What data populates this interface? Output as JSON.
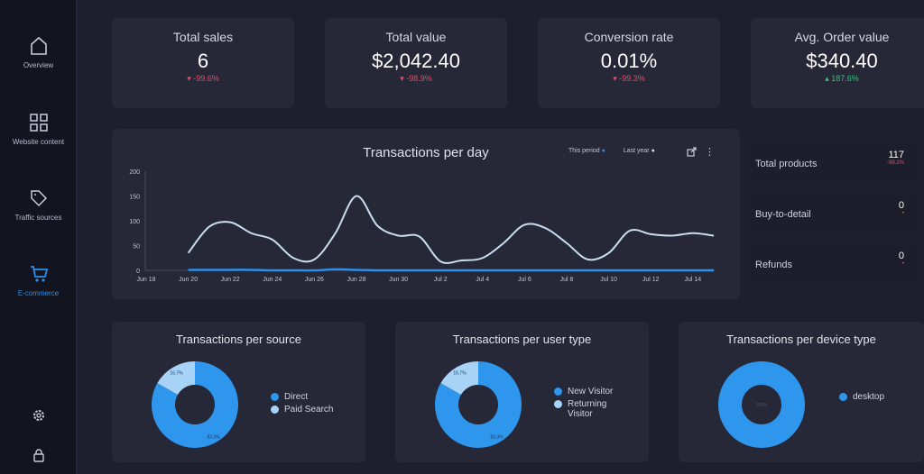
{
  "sidebar": {
    "items": [
      {
        "label": "Overview",
        "icon": "home-icon"
      },
      {
        "label": "Website content",
        "icon": "grid-icon"
      },
      {
        "label": "Traffic sources",
        "icon": "tag-icon"
      },
      {
        "label": "E-commerce",
        "icon": "cart-icon",
        "active": true
      }
    ],
    "bottom": [
      "gear-icon",
      "lock-icon"
    ]
  },
  "kpis": [
    {
      "title": "Total sales",
      "value": "6",
      "change": "-99.6%",
      "trend": "down"
    },
    {
      "title": "Total value",
      "value": "$2,042.40",
      "change": "-98.9%",
      "trend": "down"
    },
    {
      "title": "Conversion rate",
      "value": "0.01%",
      "change": "-99.3%",
      "trend": "down"
    },
    {
      "title": "Avg. Order value",
      "value": "$340.40",
      "change": "187.6%",
      "trend": "up"
    }
  ],
  "side_stats": [
    {
      "label": "Total products",
      "value": "117",
      "change": "-99.2%"
    },
    {
      "label": "Buy-to-detail",
      "value": "0",
      "change": "•"
    },
    {
      "label": "Refunds",
      "value": "0",
      "change": "•"
    }
  ],
  "colors": {
    "this_period": "#2f8ee5",
    "last_year": "#c9def0",
    "accent": "#2f8ee5",
    "negative": "#e0506a",
    "positive": "#3fbf7f"
  },
  "chart_data": [
    {
      "type": "line",
      "title": "Transactions per day",
      "legend_placement": "top-right",
      "ylim": [
        0,
        200
      ],
      "yticks": [
        "0",
        "50",
        "100",
        "150",
        "200"
      ],
      "xticks": [
        "Jun 18",
        "Jun 20",
        "Jun 22",
        "Jun 24",
        "Jun 26",
        "Jun 28",
        "Jun 30",
        "Jul 2",
        "Jul 4",
        "Jul 6",
        "Jul 8",
        "Jul 10",
        "Jul 12",
        "Jul 14"
      ],
      "x": [
        "Jun 20",
        "Jun 21",
        "Jun 22",
        "Jun 23",
        "Jun 24",
        "Jun 25",
        "Jun 26",
        "Jun 27",
        "Jun 28",
        "Jun 29",
        "Jun 30",
        "Jul 1",
        "Jul 2",
        "Jul 3",
        "Jul 4",
        "Jul 5",
        "Jul 6",
        "Jul 7",
        "Jul 8",
        "Jul 9",
        "Jul 10",
        "Jul 11",
        "Jul 12",
        "Jul 13",
        "Jul 14",
        "Jul 15"
      ],
      "series": [
        {
          "name": "This period",
          "values": [
            1,
            1,
            1,
            1,
            0,
            0,
            0,
            2,
            1,
            0,
            0,
            0,
            0,
            0,
            0,
            0,
            0,
            0,
            0,
            0,
            0,
            0,
            0,
            0,
            0,
            0
          ]
        },
        {
          "name": "Last year",
          "values": [
            35,
            88,
            97,
            75,
            62,
            25,
            22,
            75,
            150,
            90,
            70,
            68,
            18,
            20,
            25,
            55,
            92,
            85,
            55,
            22,
            35,
            80,
            73,
            70,
            75,
            70
          ]
        }
      ]
    },
    {
      "type": "pie",
      "title": "Transactions per source",
      "labels": [
        "Direct",
        "Paid Search"
      ],
      "values": [
        83.3,
        16.7
      ],
      "data_labels": [
        "83.3%",
        "16.7%"
      ],
      "colors": [
        "#2f96ee",
        "#a7d3f7"
      ]
    },
    {
      "type": "pie",
      "title": "Transactions per user type",
      "labels": [
        "New Visitor",
        "Returning Visitor"
      ],
      "values": [
        83.3,
        16.7
      ],
      "data_labels": [
        "83.3%",
        "16.7%"
      ],
      "colors": [
        "#2f96ee",
        "#a7d3f7"
      ]
    },
    {
      "type": "pie",
      "title": "Transactions per device type",
      "labels": [
        "desktop"
      ],
      "values": [
        100
      ],
      "data_labels": [
        "100%"
      ],
      "colors": [
        "#2f96ee"
      ]
    }
  ]
}
